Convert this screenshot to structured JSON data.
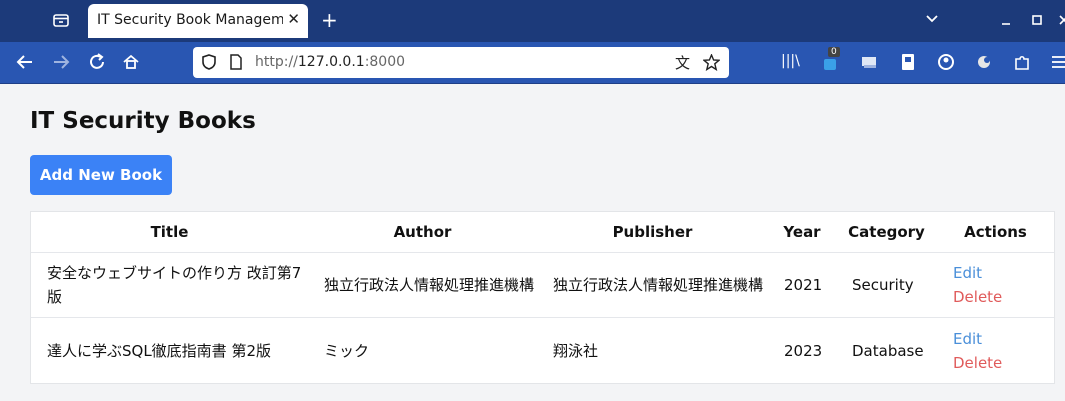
{
  "browser": {
    "tab_title": "IT Security Book Managemen",
    "tab_close": "✕",
    "new_tab": "+",
    "url_scheme": "http://",
    "url_host": "127.0.0.1",
    "url_port": ":8000",
    "extension_badge": "0"
  },
  "page": {
    "title": "IT Security Books",
    "add_button": "Add New Book"
  },
  "table": {
    "headers": [
      "Title",
      "Author",
      "Publisher",
      "Year",
      "Category",
      "Actions"
    ],
    "rows": [
      {
        "title": "安全なウェブサイトの作り方 改訂第7版",
        "author": "独立行政法人情報処理推進機構",
        "publisher": "独立行政法人情報処理推進機構",
        "year": "2021",
        "category": "Security",
        "edit": "Edit",
        "delete": "Delete"
      },
      {
        "title": "達人に学ぶSQL徹底指南書 第2版",
        "author": "ミック",
        "publisher": "翔泳社",
        "year": "2023",
        "category": "Database",
        "edit": "Edit",
        "delete": "Delete"
      }
    ]
  },
  "colors": {
    "tabbar_bg": "#1c3a7a",
    "navbar_bg": "#2956b2",
    "primary_button": "#3b82f6",
    "edit_link": "#4a8fd9",
    "delete_link": "#e05b5b"
  }
}
